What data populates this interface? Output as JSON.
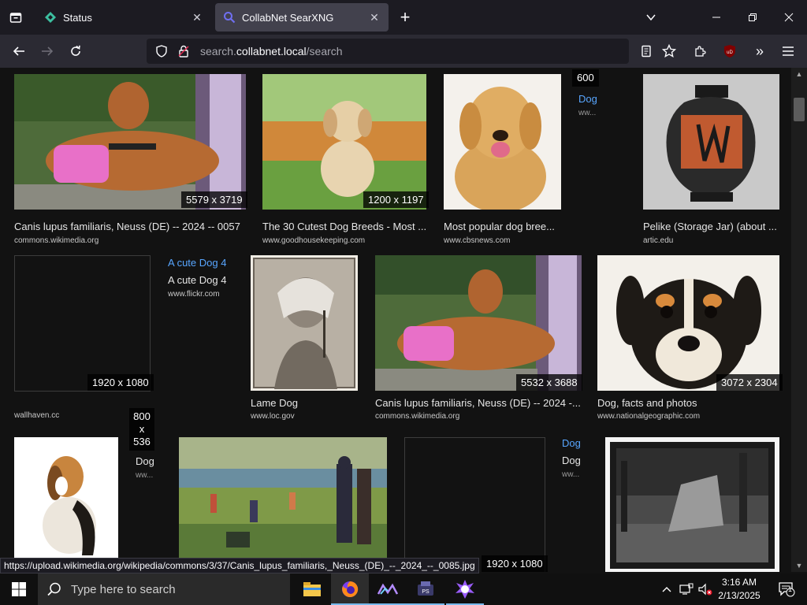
{
  "browser": {
    "tabs": [
      {
        "label": "Status",
        "favicon": "status-favicon"
      },
      {
        "label": "CollabNet SearXNG",
        "favicon": "searxng-favicon"
      }
    ],
    "url": {
      "scheme": "search.",
      "host": "collabnet.local",
      "path": "/search"
    },
    "status_url": "https://upload.wikimedia.org/wikipedia/commons/3/37/Canis_lupus_familiaris,_Neuss_(DE)_--_2024_--_0085.jpg"
  },
  "results": [
    {
      "title": "Canis lupus familiaris, Neuss (DE) -- 2024 -- 0057",
      "source": "commons.wikimedia.org",
      "dims": "5579 x 3719"
    },
    {
      "title": "The 30 Cutest Dog Breeds - Most ...",
      "source": "www.goodhousekeeping.com",
      "dims": "1200 x 1197"
    },
    {
      "title": "Most popular dog bree...",
      "source": "www.cbsnews.com",
      "dims": ""
    },
    {
      "title": "Dog",
      "source": "ww...",
      "dims": "600"
    },
    {
      "title": "Pelike (Storage Jar) (about ...",
      "source": "artic.edu",
      "dims": ""
    },
    {
      "title": "",
      "source": "wallhaven.cc",
      "dims": "1920 x 1080"
    },
    {
      "title": "A cute Dog 4",
      "alt": "A cute Dog 4",
      "source": "www.flickr.com",
      "dims": ""
    },
    {
      "title": "Lame Dog",
      "source": "www.loc.gov",
      "dims": ""
    },
    {
      "title": "Canis lupus familiaris, Neuss (DE) -- 2024 -...",
      "source": "commons.wikimedia.org",
      "dims": "5532 x 3688"
    },
    {
      "title": "Dog, facts and photos",
      "source": "www.nationalgeographic.com",
      "dims": "3072 x 2304"
    },
    {
      "title": "Dog",
      "source": "ww...",
      "dims": "800 x 536"
    },
    {
      "title": "Dog",
      "alt": "Dog",
      "source": "ww...",
      "dims": "1920 x 1080"
    }
  ],
  "taskbar": {
    "search_placeholder": "Type here to search",
    "time": "3:16 AM",
    "date": "2/13/2025",
    "notification_count": "1"
  }
}
